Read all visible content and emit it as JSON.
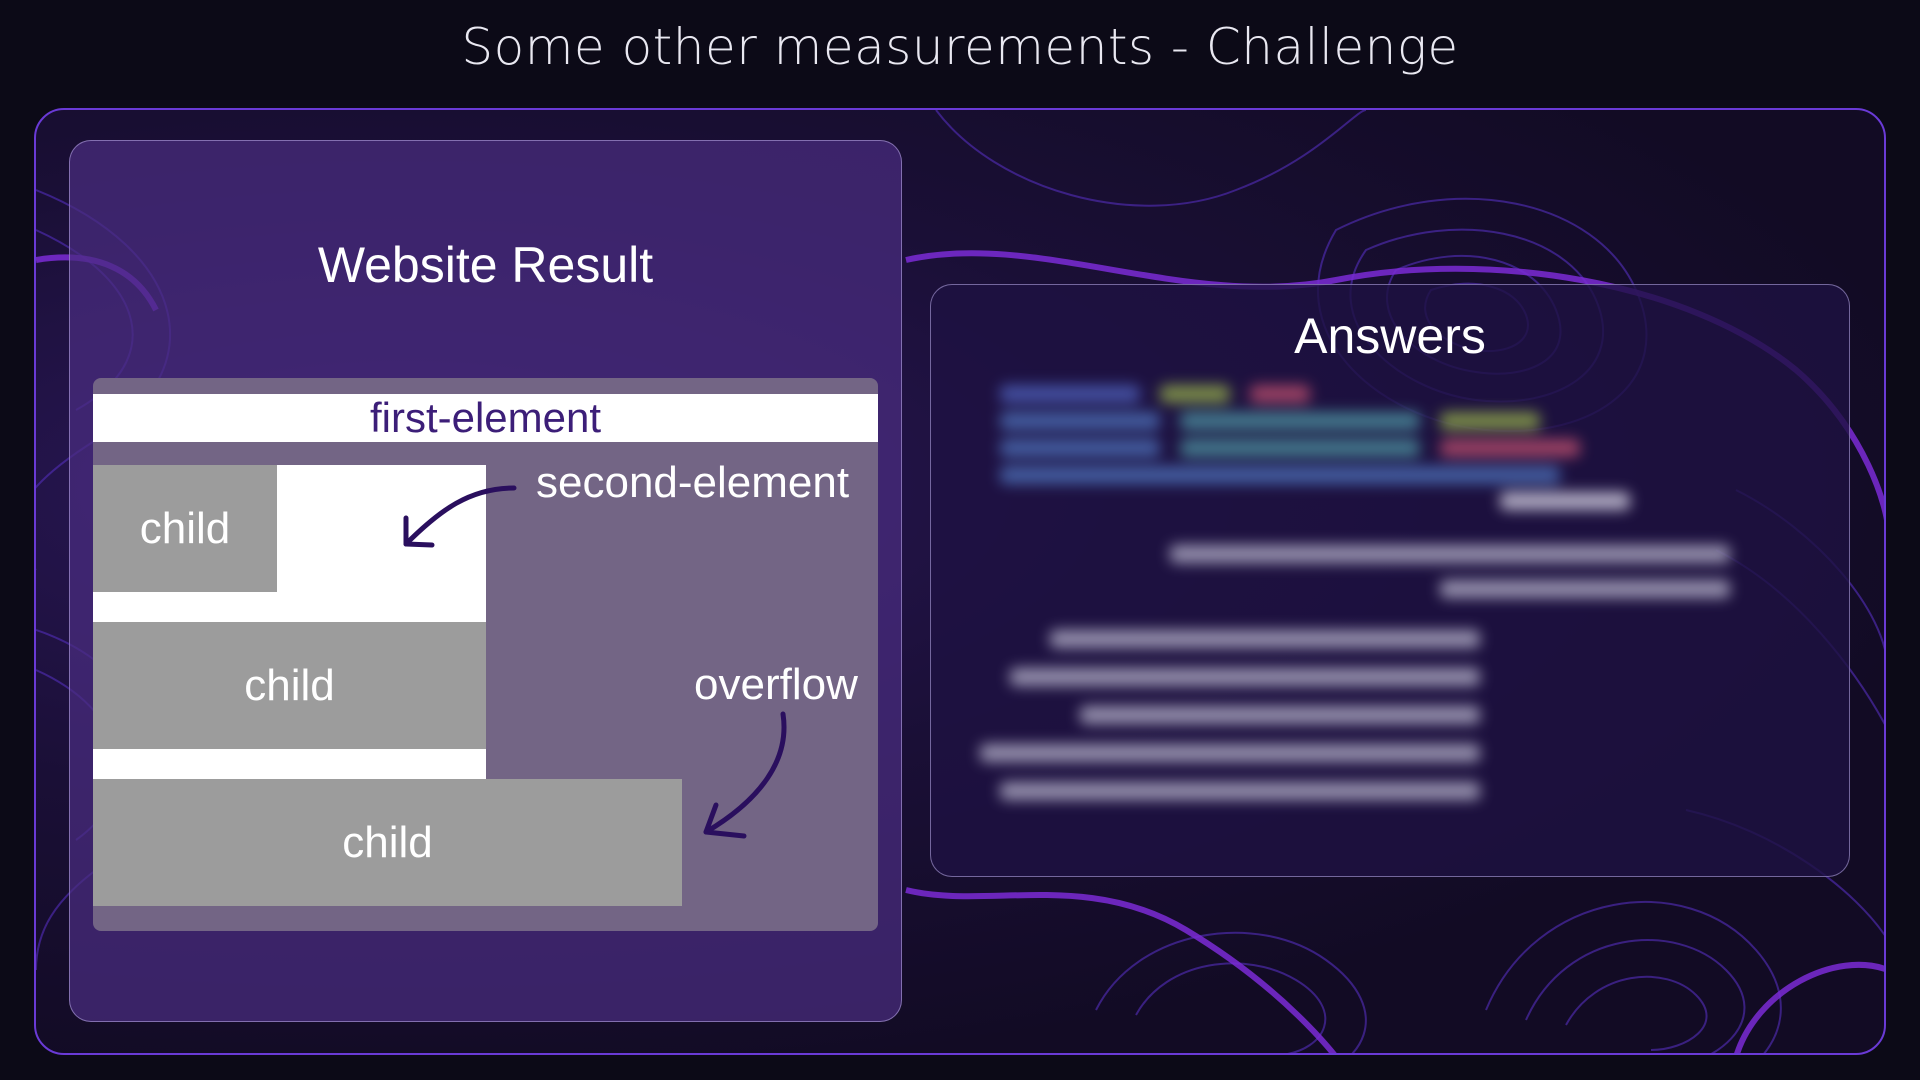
{
  "slide": {
    "title": "Some other measurements - Challenge"
  },
  "left_panel": {
    "title": "Website Result",
    "first_element_label": "first-element",
    "children": [
      "child",
      "child",
      "child"
    ],
    "annotation_second": "second-element",
    "annotation_overflow": "overflow"
  },
  "right_panel": {
    "title": "Answers"
  },
  "colors": {
    "background": "#0c0a17",
    "accent": "#6a3ad6",
    "child_gray": "#9c9c9c",
    "arrow": "#2a0f5e"
  }
}
